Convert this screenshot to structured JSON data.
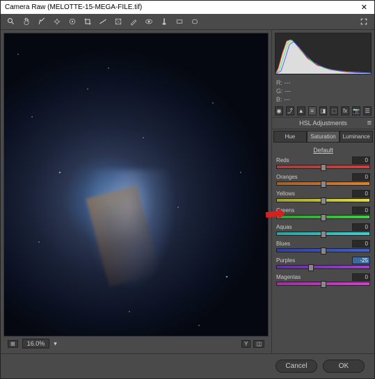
{
  "title": "Camera Raw (MELOTTE-15-MEGA-FILE.tif)",
  "zoom": "16.0%",
  "rgb": {
    "r_label": "R:",
    "g_label": "G:",
    "b_label": "B:",
    "r": "---",
    "g": "---",
    "b": "---"
  },
  "panel": {
    "title": "HSL Adjustments",
    "tabs": {
      "hue": "Hue",
      "sat": "Saturation",
      "lum": "Luminance"
    },
    "default": "Default"
  },
  "sliders": {
    "reds": {
      "label": "Reds",
      "value": "0",
      "pos": 50
    },
    "oranges": {
      "label": "Oranges",
      "value": "0",
      "pos": 50
    },
    "yellows": {
      "label": "Yellows",
      "value": "0",
      "pos": 50
    },
    "greens": {
      "label": "Greens",
      "value": "0",
      "pos": 50
    },
    "aquas": {
      "label": "Aquas",
      "value": "0",
      "pos": 50
    },
    "blues": {
      "label": "Blues",
      "value": "0",
      "pos": 50
    },
    "purples": {
      "label": "Purples",
      "value": "-25",
      "pos": 37
    },
    "magentas": {
      "label": "Magentas",
      "value": "0",
      "pos": 50
    }
  },
  "footer": {
    "cancel": "Cancel",
    "ok": "OK"
  }
}
